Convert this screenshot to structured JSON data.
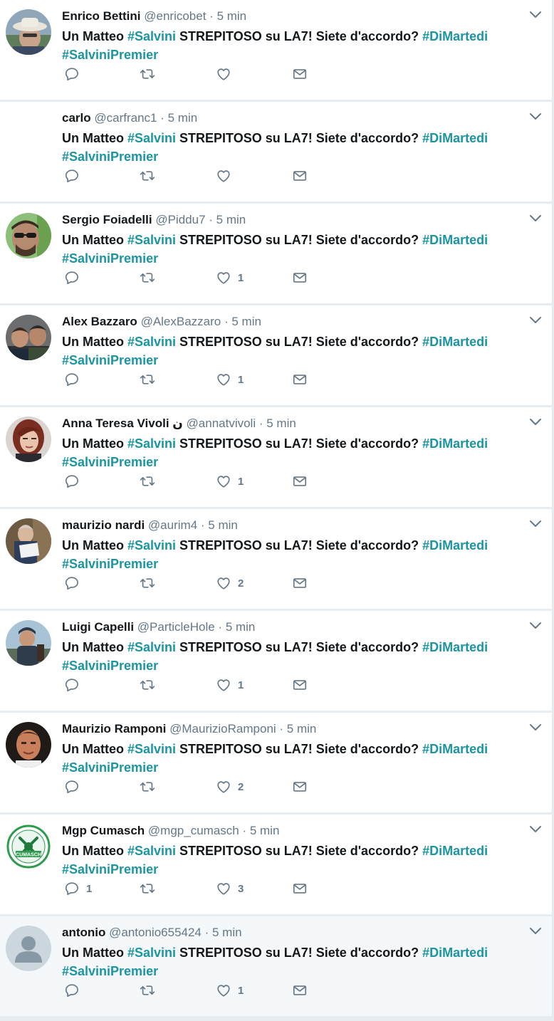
{
  "colors": {
    "hashtag": "#1b95a0",
    "name": "#14171a",
    "meta": "#657786",
    "background": "#e6ecf0"
  },
  "tweets": [
    {
      "name": "Enrico Bettini",
      "handle": "@enricobet",
      "time": "5 min",
      "text_parts": [
        "Un Matteo ",
        "#Salvini",
        " STREPITOSO su LA7! Siete d'accordo? ",
        "#DiMartedi",
        " ",
        "#SalviniPremier"
      ],
      "reply_count": "",
      "retweet_count": "",
      "like_count": "",
      "avatar": "photo-hat",
      "highlighted": false
    },
    {
      "name": "carlo",
      "handle": "@carfranc1",
      "time": "5 min",
      "text_parts": [
        "Un Matteo ",
        "#Salvini",
        " STREPITOSO su LA7! Siete d'accordo? ",
        "#DiMartedi",
        " ",
        "#SalviniPremier"
      ],
      "reply_count": "",
      "retweet_count": "",
      "like_count": "",
      "avatar": "none",
      "highlighted": false
    },
    {
      "name": "Sergio Foiadelli",
      "handle": "@Piddu7",
      "time": "5 min",
      "text_parts": [
        "Un Matteo ",
        "#Salvini",
        " STREPITOSO su LA7! Siete d'accordo? ",
        "#DiMartedi",
        " ",
        "#SalviniPremier"
      ],
      "reply_count": "",
      "retweet_count": "",
      "like_count": "1",
      "avatar": "photo-sunglasses",
      "highlighted": false
    },
    {
      "name": "Alex Bazzaro",
      "handle": "@AlexBazzaro",
      "time": "5 min",
      "text_parts": [
        "Un Matteo ",
        "#Salvini",
        " STREPITOSO su LA7! Siete d'accordo? ",
        "#DiMartedi",
        " ",
        "#SalviniPremier"
      ],
      "reply_count": "",
      "retweet_count": "",
      "like_count": "1",
      "avatar": "photo-two-men",
      "highlighted": false
    },
    {
      "name": "Anna Teresa Vivoli ن",
      "handle": "@annatvivoli",
      "time": "5 min",
      "text_parts": [
        "Un Matteo ",
        "#Salvini",
        " STREPITOSO su LA7! Siete d'accordo? ",
        "#DiMartedi",
        " ",
        "#SalviniPremier"
      ],
      "reply_count": "",
      "retweet_count": "",
      "like_count": "1",
      "avatar": "photo-woman",
      "highlighted": false
    },
    {
      "name": "maurizio nardi",
      "handle": "@aurim4",
      "time": "5 min",
      "text_parts": [
        "Un Matteo ",
        "#Salvini",
        " STREPITOSO su LA7! Siete d'accordo? ",
        "#DiMartedi",
        " ",
        "#SalviniPremier"
      ],
      "reply_count": "",
      "retweet_count": "",
      "like_count": "2",
      "avatar": "photo-reading",
      "highlighted": false
    },
    {
      "name": "Luigi Capelli",
      "handle": "@ParticleHole",
      "time": "5 min",
      "text_parts": [
        "Un Matteo ",
        "#Salvini",
        " STREPITOSO su LA7! Siete d'accordo? ",
        "#DiMartedi",
        " ",
        "#SalviniPremier"
      ],
      "reply_count": "",
      "retweet_count": "",
      "like_count": "1",
      "avatar": "photo-outdoor",
      "highlighted": false
    },
    {
      "name": "Maurizio Ramponi",
      "handle": "@MaurizioRamponi",
      "time": "5 min",
      "text_parts": [
        "Un Matteo ",
        "#Salvini",
        " STREPITOSO su LA7! Siete d'accordo? ",
        "#DiMartedi",
        " ",
        "#SalviniPremier"
      ],
      "reply_count": "",
      "retweet_count": "",
      "like_count": "2",
      "avatar": "photo-face",
      "highlighted": false
    },
    {
      "name": "Mgp Cumasch",
      "handle": "@mgp_cumasch",
      "time": "5 min",
      "text_parts": [
        "Un Matteo ",
        "#Salvini",
        " STREPITOSO su LA7! Siete d'accordo? ",
        "#DiMartedi",
        " ",
        "#SalviniPremier"
      ],
      "reply_count": "1",
      "retweet_count": "",
      "like_count": "3",
      "avatar": "logo-cumasch",
      "avatar_text": "CUMASCH",
      "highlighted": false
    },
    {
      "name": "antonio",
      "handle": "@antonio655424",
      "time": "5 min",
      "text_parts": [
        "Un Matteo ",
        "#Salvini",
        " STREPITOSO su LA7! Siete d'accordo? ",
        "#DiMartedi",
        " ",
        "#SalviniPremier"
      ],
      "reply_count": "",
      "retweet_count": "",
      "like_count": "1",
      "avatar": "default-egg",
      "highlighted": true
    }
  ],
  "separator": " · ",
  "icons": {
    "reply": "reply-icon",
    "retweet": "retweet-icon",
    "like": "heart-icon",
    "dm": "envelope-icon",
    "caret": "chevron-down-icon"
  }
}
